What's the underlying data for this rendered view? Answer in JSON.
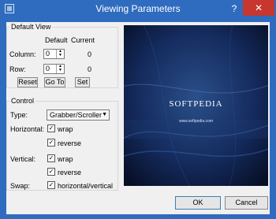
{
  "window": {
    "title": "Viewing Parameters",
    "help": "?",
    "close": "✕"
  },
  "default_view": {
    "legend": "Default View",
    "col_default": "Default",
    "col_current": "Current",
    "rows": [
      {
        "label": "Column:",
        "default": "0",
        "current": "0"
      },
      {
        "label": "Row:",
        "default": "0",
        "current": "0"
      }
    ],
    "buttons": {
      "reset": "Reset",
      "goto": "Go To",
      "set": "Set"
    }
  },
  "control": {
    "legend": "Control",
    "type_label": "Type:",
    "type_value": "Grabber/Scroller",
    "horizontal_label": "Horizontal:",
    "h_wrap": "wrap",
    "h_reverse": "reverse",
    "vertical_label": "Vertical:",
    "v_wrap": "wrap",
    "v_reverse": "reverse",
    "swap_label": "Swap:",
    "swap_value": "horizontal/vertical",
    "check": "✓"
  },
  "preview": {
    "brand": "SOFTPEDIA",
    "url": "www.softpedia.com"
  },
  "dialog": {
    "ok": "OK",
    "cancel": "Cancel"
  }
}
